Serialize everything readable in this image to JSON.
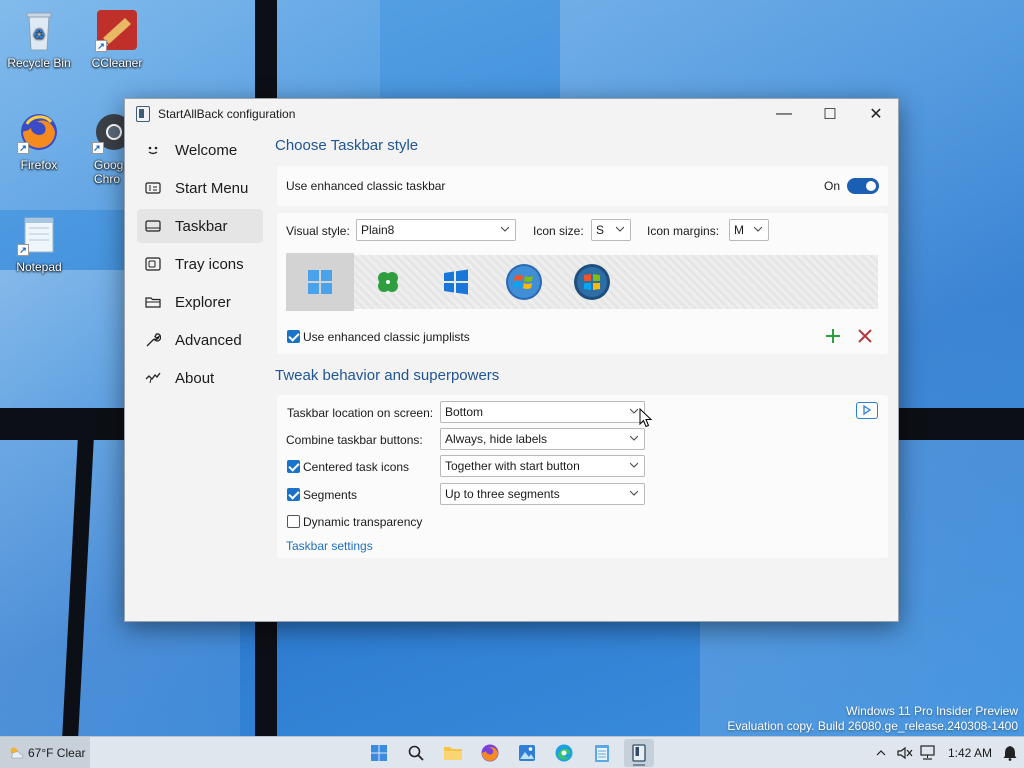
{
  "desktop": {
    "icons": [
      {
        "label": "Recycle Bin"
      },
      {
        "label": "CCleaner"
      },
      {
        "label": "Firefox"
      },
      {
        "label": "Goog\nChro"
      },
      {
        "label": "Notepad"
      }
    ],
    "watermark_line1": "Windows 11 Pro Insider Preview",
    "watermark_line2": "Evaluation copy. Build 26080.ge_release.240308-1400"
  },
  "window": {
    "title": "StartAllBack configuration",
    "controls": {
      "minimize": "—",
      "maximize": "☐",
      "close": "✕"
    }
  },
  "sidebar": {
    "items": [
      {
        "label": "Welcome",
        "icon": "smile-icon"
      },
      {
        "label": "Start Menu",
        "icon": "start-menu-icon"
      },
      {
        "label": "Taskbar",
        "icon": "taskbar-icon",
        "active": true
      },
      {
        "label": "Tray icons",
        "icon": "tray-icon"
      },
      {
        "label": "Explorer",
        "icon": "folder-icon"
      },
      {
        "label": "Advanced",
        "icon": "wrench-icon"
      },
      {
        "label": "About",
        "icon": "about-icon"
      }
    ]
  },
  "taskbar_style": {
    "section_title": "Choose Taskbar style",
    "enhanced_label": "Use enhanced classic taskbar",
    "enhanced_state": "On",
    "visual_style_label": "Visual style:",
    "visual_style_value": "Plain8",
    "icon_size_label": "Icon size:",
    "icon_size_value": "S",
    "icon_margins_label": "Icon margins:",
    "icon_margins_value": "M",
    "styles": [
      "windows-11-logo",
      "clover-logo",
      "windows-10-logo",
      "windows-7-orb",
      "windows-vista-orb"
    ],
    "jumplists_label": "Use enhanced classic jumplists",
    "jumplists_checked": true
  },
  "tweak": {
    "section_title": "Tweak behavior and superpowers",
    "location_label": "Taskbar location on screen:",
    "location_value": "Bottom",
    "combine_label": "Combine taskbar buttons:",
    "combine_value": "Always, hide labels",
    "centered_label": "Centered task icons",
    "centered_checked": true,
    "centered_value": "Together with start button",
    "segments_label": "Segments",
    "segments_checked": true,
    "segments_value": "Up to three segments",
    "dynamic_label": "Dynamic transparency",
    "dynamic_checked": false,
    "settings_link": "Taskbar settings"
  },
  "taskbar": {
    "weather": "67°F Clear",
    "time": "1:42 AM",
    "apps": [
      "start-icon",
      "search-icon",
      "file-explorer-icon",
      "firefox-icon",
      "photos-icon",
      "edge-icon",
      "notepad-icon",
      "startallback-icon"
    ]
  },
  "colors": {
    "accent": "#1a73c8",
    "section_title": "#1f5597",
    "add": "#2e9e3e",
    "remove": "#b3393c"
  }
}
